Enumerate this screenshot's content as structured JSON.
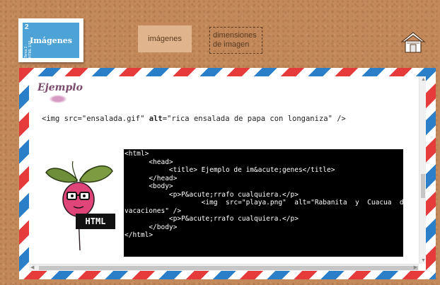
{
  "stamp": {
    "number": "2",
    "side_text": "Tema 2 · HTML 1/15",
    "title": "Imágenes"
  },
  "nav": {
    "tab_imagenes": "imágenes",
    "tab_dimensiones": "dimensiones\nde imagen"
  },
  "content": {
    "heading": "Ejemplo",
    "code_example": {
      "tag_open": "<img src=\"ensalada.gif\" ",
      "alt_attr": "alt",
      "tag_rest": "=\"rica ensalada de papa con longaniza\" />"
    },
    "illustration_label": "HTML",
    "terminal_lines": [
      "<html>",
      "",
      "      <head>",
      "           <title> Ejemplo de im&acute;genes</title>",
      "      </head>",
      "",
      "      <body>",
      "           <p>P&acute;rrafo cualquiera.</p>",
      "                   <img  src=\"playa.png\"  alt=\"Rabanita  y  Cuacua  de",
      "vacaciones\" />",
      "           <p>P&acute;rrafo cualquiera.</p>",
      "      </body>",
      "",
      "</html>"
    ]
  },
  "colors": {
    "background": "#c4895a",
    "stamp_blue": "#4ea3d6",
    "envelope_red": "#e53b3b",
    "envelope_blue": "#2b7fc9",
    "tab_active": "#e0b48c"
  },
  "icons": {
    "home": "home-icon",
    "scroll_up": "arrow-up-icon",
    "scroll_down": "arrow-down-icon",
    "scroll_left": "arrow-left-icon",
    "scroll_right": "arrow-right-icon"
  }
}
